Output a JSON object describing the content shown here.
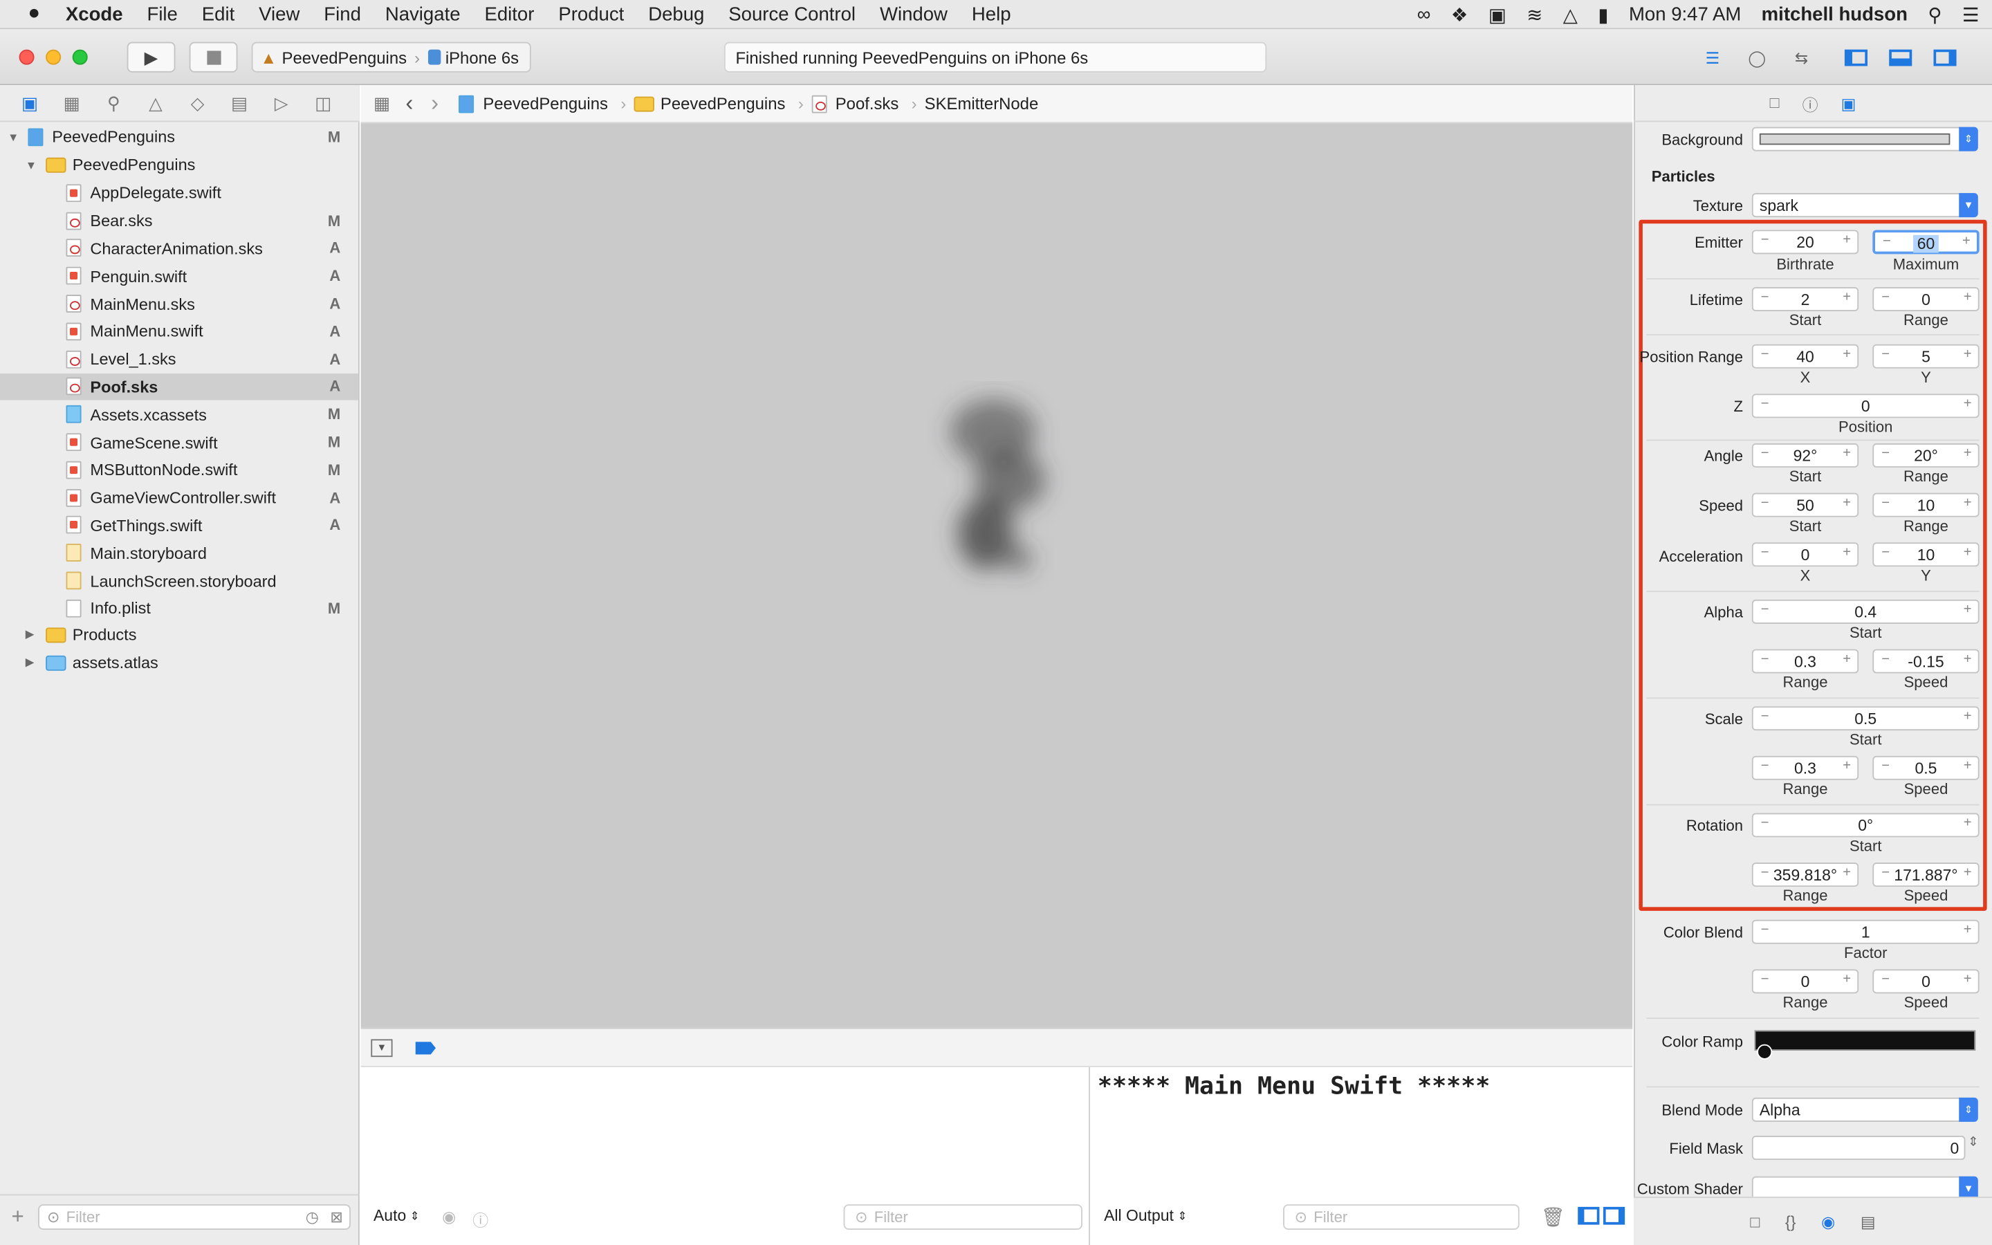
{
  "menubar": {
    "app": "Xcode",
    "items": [
      "File",
      "Edit",
      "View",
      "Find",
      "Navigate",
      "Editor",
      "Product",
      "Debug",
      "Source Control",
      "Window",
      "Help"
    ],
    "clock": "Mon 9:47 AM",
    "user": "mitchell hudson"
  },
  "toolbar": {
    "scheme": "PeevedPenguins",
    "device": "iPhone 6s",
    "activity": "Finished running PeevedPenguins on iPhone 6s"
  },
  "navigator": {
    "project": {
      "name": "PeevedPenguins",
      "status": "M"
    },
    "group": {
      "name": "PeevedPenguins"
    },
    "files": [
      {
        "name": "AppDelegate.swift",
        "status": "",
        "kind": "swift"
      },
      {
        "name": "Bear.sks",
        "status": "M",
        "kind": "sks"
      },
      {
        "name": "CharacterAnimation.sks",
        "status": "A",
        "kind": "sks"
      },
      {
        "name": "Penguin.swift",
        "status": "A",
        "kind": "swift"
      },
      {
        "name": "MainMenu.sks",
        "status": "A",
        "kind": "sks"
      },
      {
        "name": "MainMenu.swift",
        "status": "A",
        "kind": "swift"
      },
      {
        "name": "Level_1.sks",
        "status": "A",
        "kind": "sks"
      },
      {
        "name": "Poof.sks",
        "status": "A",
        "kind": "sks",
        "selected": true
      },
      {
        "name": "Assets.xcassets",
        "status": "M",
        "kind": "asset"
      },
      {
        "name": "GameScene.swift",
        "status": "M",
        "kind": "swift"
      },
      {
        "name": "MSButtonNode.swift",
        "status": "M",
        "kind": "swift"
      },
      {
        "name": "GameViewController.swift",
        "status": "A",
        "kind": "swift"
      },
      {
        "name": "GetThings.swift",
        "status": "A",
        "kind": "swift"
      },
      {
        "name": "Main.storyboard",
        "status": "",
        "kind": "sb"
      },
      {
        "name": "LaunchScreen.storyboard",
        "status": "",
        "kind": "sb"
      },
      {
        "name": "Info.plist",
        "status": "M",
        "kind": "plist"
      }
    ],
    "folders": [
      {
        "name": "Products"
      },
      {
        "name": "assets.atlas"
      }
    ],
    "filter_placeholder": "Filter"
  },
  "jumpbar": {
    "crumbs": [
      "PeevedPenguins",
      "PeevedPenguins",
      "Poof.sks",
      "SKEmitterNode"
    ]
  },
  "debug": {
    "auto_label": "Auto",
    "filter_placeholder": "Filter",
    "output_label": "All Output",
    "console_text": "***** Main Menu Swift *****"
  },
  "inspector": {
    "background_label": "Background",
    "particles_header": "Particles",
    "texture": {
      "label": "Texture",
      "value": "spark"
    },
    "emitter": {
      "label": "Emitter",
      "birthrate": "20",
      "maximum": "60",
      "sub1": "Birthrate",
      "sub2": "Maximum"
    },
    "lifetime": {
      "label": "Lifetime",
      "start": "2",
      "range": "0",
      "sub1": "Start",
      "sub2": "Range"
    },
    "position_range": {
      "label": "Position Range",
      "x": "40",
      "y": "5",
      "sub1": "X",
      "sub2": "Y"
    },
    "z": {
      "label": "Z",
      "value": "0",
      "sub": "Position"
    },
    "angle": {
      "label": "Angle",
      "start": "92°",
      "range": "20°",
      "sub1": "Start",
      "sub2": "Range"
    },
    "speed": {
      "label": "Speed",
      "start": "50",
      "range": "10",
      "sub1": "Start",
      "sub2": "Range"
    },
    "acceleration": {
      "label": "Acceleration",
      "x": "0",
      "y": "10",
      "sub1": "X",
      "sub2": "Y"
    },
    "alpha": {
      "label": "Alpha",
      "start": "0.4",
      "sub": "Start",
      "range": "0.3",
      "speed": "-0.15",
      "sub1": "Range",
      "sub2": "Speed"
    },
    "scale": {
      "label": "Scale",
      "start": "0.5",
      "sub": "Start",
      "range": "0.3",
      "speed": "0.5",
      "sub1": "Range",
      "sub2": "Speed"
    },
    "rotation": {
      "label": "Rotation",
      "start": "0°",
      "sub": "Start",
      "range": "359.818°",
      "speed": "171.887°",
      "sub1": "Range",
      "sub2": "Speed"
    },
    "color_blend": {
      "label": "Color Blend",
      "factor": "1",
      "sub": "Factor",
      "range": "0",
      "speed": "0",
      "sub1": "Range",
      "sub2": "Speed"
    },
    "color_ramp": {
      "label": "Color Ramp"
    },
    "blend_mode": {
      "label": "Blend Mode",
      "value": "Alpha"
    },
    "field_mask": {
      "label": "Field Mask",
      "value": "0"
    },
    "custom_shader": {
      "label": "Custom Shader"
    }
  }
}
